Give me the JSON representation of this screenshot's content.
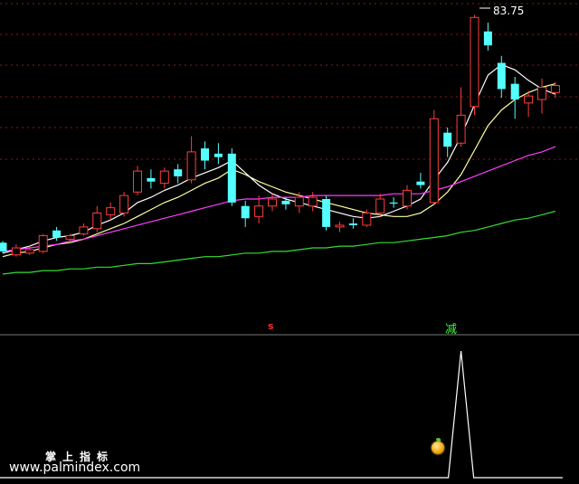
{
  "chart_data": {
    "type": "candlestick",
    "peak_label": "83.75",
    "candles": [
      {
        "o": 70.2,
        "c": 70.7,
        "h": 70.8,
        "l": 70.1,
        "dir": "down"
      },
      {
        "o": 70.0,
        "c": 70.4,
        "h": 70.6,
        "l": 69.9,
        "dir": "up"
      },
      {
        "o": 70.1,
        "c": 70.3,
        "h": 70.5,
        "l": 70.0,
        "dir": "up"
      },
      {
        "o": 70.2,
        "c": 71.1,
        "h": 71.2,
        "l": 70.1,
        "dir": "up"
      },
      {
        "o": 71.4,
        "c": 71.0,
        "h": 71.6,
        "l": 70.8,
        "dir": "down"
      },
      {
        "o": 70.9,
        "c": 71.1,
        "h": 71.2,
        "l": 70.8,
        "dir": "up"
      },
      {
        "o": 71.2,
        "c": 71.6,
        "h": 71.8,
        "l": 71.1,
        "dir": "up"
      },
      {
        "o": 71.5,
        "c": 72.4,
        "h": 72.8,
        "l": 71.3,
        "dir": "up"
      },
      {
        "o": 72.3,
        "c": 72.7,
        "h": 73.0,
        "l": 72.0,
        "dir": "up"
      },
      {
        "o": 72.4,
        "c": 73.4,
        "h": 73.6,
        "l": 72.2,
        "dir": "up"
      },
      {
        "o": 73.6,
        "c": 74.8,
        "h": 75.1,
        "l": 73.4,
        "dir": "up"
      },
      {
        "o": 74.4,
        "c": 74.2,
        "h": 74.9,
        "l": 73.8,
        "dir": "down"
      },
      {
        "o": 74.1,
        "c": 74.8,
        "h": 75.0,
        "l": 73.8,
        "dir": "up"
      },
      {
        "o": 74.5,
        "c": 74.9,
        "h": 75.2,
        "l": 74.1,
        "dir": "down"
      },
      {
        "o": 74.3,
        "c": 75.9,
        "h": 76.8,
        "l": 74.1,
        "dir": "up"
      },
      {
        "o": 76.1,
        "c": 75.4,
        "h": 76.5,
        "l": 74.9,
        "dir": "down"
      },
      {
        "o": 75.6,
        "c": 75.8,
        "h": 76.4,
        "l": 75.2,
        "dir": "down"
      },
      {
        "o": 75.8,
        "c": 73.0,
        "h": 76.1,
        "l": 72.8,
        "dir": "down"
      },
      {
        "o": 72.8,
        "c": 72.1,
        "h": 73.1,
        "l": 71.6,
        "dir": "down"
      },
      {
        "o": 72.2,
        "c": 72.8,
        "h": 73.4,
        "l": 71.8,
        "dir": "up"
      },
      {
        "o": 72.8,
        "c": 73.2,
        "h": 73.5,
        "l": 72.5,
        "dir": "up"
      },
      {
        "o": 73.1,
        "c": 72.9,
        "h": 73.3,
        "l": 72.6,
        "dir": "down"
      },
      {
        "o": 72.8,
        "c": 73.3,
        "h": 73.6,
        "l": 72.4,
        "dir": "up"
      },
      {
        "o": 73.3,
        "c": 72.8,
        "h": 73.6,
        "l": 72.5,
        "dir": "up"
      },
      {
        "o": 73.2,
        "c": 71.6,
        "h": 73.4,
        "l": 71.4,
        "dir": "down"
      },
      {
        "o": 71.6,
        "c": 71.7,
        "h": 71.9,
        "l": 71.3,
        "dir": "up"
      },
      {
        "o": 71.7,
        "c": 71.8,
        "h": 72.1,
        "l": 71.5,
        "dir": "down"
      },
      {
        "o": 71.7,
        "c": 72.4,
        "h": 72.6,
        "l": 71.6,
        "dir": "up"
      },
      {
        "o": 72.4,
        "c": 73.2,
        "h": 73.5,
        "l": 72.2,
        "dir": "up"
      },
      {
        "o": 73.0,
        "c": 73.0,
        "h": 73.3,
        "l": 72.7,
        "dir": "down"
      },
      {
        "o": 72.8,
        "c": 73.7,
        "h": 74.0,
        "l": 72.6,
        "dir": "up"
      },
      {
        "o": 74.0,
        "c": 74.2,
        "h": 74.7,
        "l": 73.8,
        "dir": "down"
      },
      {
        "o": 73.0,
        "c": 77.8,
        "h": 78.3,
        "l": 72.9,
        "dir": "up"
      },
      {
        "o": 77.0,
        "c": 76.2,
        "h": 77.3,
        "l": 75.6,
        "dir": "down"
      },
      {
        "o": 76.4,
        "c": 78.0,
        "h": 79.6,
        "l": 76.2,
        "dir": "up"
      },
      {
        "o": 78.5,
        "c": 83.6,
        "h": 83.75,
        "l": 78.0,
        "dir": "up"
      },
      {
        "o": 82.8,
        "c": 82.0,
        "h": 83.3,
        "l": 81.7,
        "dir": "down"
      },
      {
        "o": 81.0,
        "c": 79.5,
        "h": 81.4,
        "l": 79.0,
        "dir": "down"
      },
      {
        "o": 79.8,
        "c": 78.9,
        "h": 80.2,
        "l": 77.8,
        "dir": "down"
      },
      {
        "o": 78.7,
        "c": 79.1,
        "h": 79.4,
        "l": 77.9,
        "dir": "up"
      },
      {
        "o": 78.9,
        "c": 79.6,
        "h": 80.1,
        "l": 78.1,
        "dir": "up"
      },
      {
        "o": 79.3,
        "c": 79.7,
        "h": 79.9,
        "l": 79.0,
        "dir": "up"
      }
    ],
    "ma_series": [
      {
        "color": "#ffffa0",
        "values": [
          69.9,
          70.1,
          70.2,
          70.4,
          70.6,
          70.7,
          70.9,
          71.2,
          71.5,
          71.8,
          72.2,
          72.6,
          73.0,
          73.3,
          73.7,
          74.1,
          74.4,
          74.9,
          74.6,
          74.2,
          73.9,
          73.6,
          73.4,
          73.2,
          73.0,
          72.8,
          72.6,
          72.4,
          72.3,
          72.2,
          72.2,
          72.4,
          72.9,
          73.6,
          74.6,
          76.0,
          77.4,
          78.3,
          78.9,
          79.3,
          79.6,
          79.8
        ]
      },
      {
        "color": "#ffffff",
        "values": [
          70.1,
          70.3,
          70.5,
          70.8,
          71.0,
          71.1,
          71.3,
          71.7,
          72.0,
          72.4,
          73.0,
          73.3,
          73.7,
          74.0,
          74.4,
          74.7,
          75.0,
          75.4,
          74.7,
          74.0,
          73.5,
          73.2,
          73.0,
          72.8,
          72.6,
          72.4,
          72.2,
          72.1,
          72.2,
          72.5,
          72.8,
          73.2,
          74.3,
          75.3,
          76.8,
          78.6,
          80.3,
          80.9,
          80.6,
          80.0,
          79.5,
          79.2
        ]
      },
      {
        "color": "#ff3cff",
        "values": [
          70.2,
          70.3,
          70.4,
          70.5,
          70.6,
          70.8,
          70.9,
          71.1,
          71.3,
          71.5,
          71.7,
          71.9,
          72.1,
          72.3,
          72.5,
          72.7,
          72.9,
          73.1,
          73.2,
          73.2,
          73.3,
          73.3,
          73.3,
          73.4,
          73.4,
          73.4,
          73.4,
          73.4,
          73.4,
          73.5,
          73.5,
          73.5,
          73.7,
          73.9,
          74.2,
          74.5,
          74.8,
          75.1,
          75.4,
          75.7,
          75.9,
          76.2
        ]
      },
      {
        "color": "#33dd33",
        "values": [
          68.9,
          69.0,
          69.0,
          69.1,
          69.1,
          69.2,
          69.2,
          69.3,
          69.3,
          69.4,
          69.5,
          69.5,
          69.6,
          69.7,
          69.8,
          69.9,
          69.9,
          70.0,
          70.1,
          70.1,
          70.2,
          70.2,
          70.3,
          70.4,
          70.4,
          70.5,
          70.5,
          70.6,
          70.7,
          70.7,
          70.8,
          70.9,
          71.0,
          71.1,
          71.3,
          71.4,
          71.6,
          71.8,
          72.0,
          72.1,
          72.3,
          72.5
        ]
      }
    ],
    "ylim": [
      67.5,
      84.6
    ],
    "indicator": {
      "values": [
        0,
        0,
        0,
        0,
        0,
        0,
        0,
        0,
        0,
        0,
        0,
        0,
        0,
        0,
        0,
        0,
        0,
        0,
        0,
        0,
        0,
        0,
        0,
        0,
        0,
        0,
        0,
        0,
        0,
        0,
        0,
        0,
        0,
        0,
        1,
        0,
        0,
        0,
        0,
        0,
        0,
        0
      ],
      "ylim": [
        0,
        1
      ]
    },
    "signals": {
      "s_label": "s",
      "jian_label": "减"
    }
  },
  "watermark": {
    "title": "掌上指标",
    "url": "www.palmindex.com"
  },
  "colors": {
    "up": "#ff3c3c",
    "down": "#54ffff",
    "grid": "#8b1a1a"
  }
}
